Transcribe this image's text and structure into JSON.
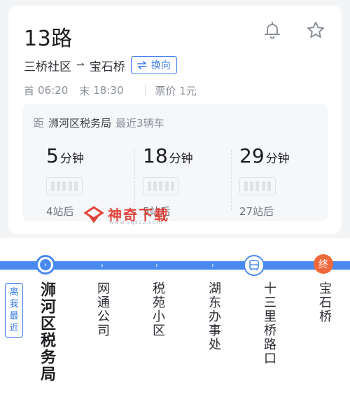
{
  "header": {
    "route_name": "13路",
    "bell_icon": "bell-icon",
    "star_icon": "star-icon"
  },
  "direction": {
    "from": "三桥社区",
    "arrow": "⇀",
    "to": "宝石桥",
    "swap_label": "换向"
  },
  "schedule": {
    "first_label": "首",
    "first_time": "06:20",
    "last_label": "末",
    "last_time": "18:30",
    "fare": "票价 1元"
  },
  "arrival": {
    "prefix": "距",
    "stop": "浉河区税务局",
    "suffix": "最近3辆车",
    "buses": [
      {
        "minutes": "5",
        "unit": "分钟",
        "stops": "4站后"
      },
      {
        "minutes": "18",
        "unit": "分钟",
        "stops": "5站后"
      },
      {
        "minutes": "29",
        "unit": "分钟",
        "stops": "27站后"
      }
    ]
  },
  "watermark": {
    "text": "神奇下载",
    "url": "www.sqxzz.com"
  },
  "line": {
    "nearest_tag": "离我最近",
    "end_marker": "终",
    "stops": [
      "浉河区税务局",
      "网通公司",
      "税苑小区",
      "湖东办事处",
      "十三里桥路口",
      "宝石桥"
    ]
  },
  "colors": {
    "accent": "#3a78e6",
    "track": "#4a8af0",
    "terminus": "#f0693a"
  }
}
